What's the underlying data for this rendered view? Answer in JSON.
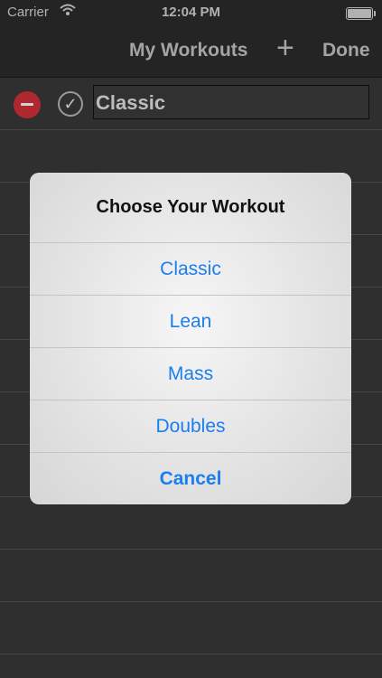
{
  "status_bar": {
    "carrier": "Carrier",
    "time": "12:04 PM"
  },
  "nav": {
    "title": "My Workouts",
    "add_label": "+",
    "done_label": "Done"
  },
  "list": {
    "rows": [
      {
        "name": "Classic"
      }
    ]
  },
  "alert": {
    "title": "Choose Your Workout",
    "options": [
      "Classic",
      "Lean",
      "Mass",
      "Doubles"
    ],
    "cancel_label": "Cancel"
  },
  "colors": {
    "accent": "#1a7ef0",
    "delete": "#d8303a",
    "background": "#3a3a3a"
  }
}
